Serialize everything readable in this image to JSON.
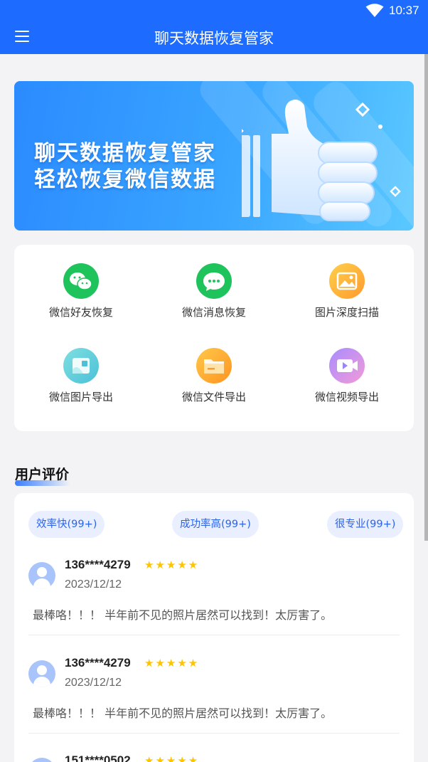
{
  "status_bar": {
    "time": "10:37",
    "wifi_icon": "wifi-icon"
  },
  "app_bar": {
    "title": "聊天数据恢复管家",
    "menu_icon": "menu-icon"
  },
  "banner": {
    "line1": "聊天数据恢复管家",
    "line2": "轻松恢复微信数据",
    "illustration": "thumbs-up-icon"
  },
  "features": [
    {
      "label": "微信好友恢复",
      "icon": "wechat-friends-icon",
      "color": "#1fc35c"
    },
    {
      "label": "微信消息恢复",
      "icon": "chat-bubble-icon",
      "color": "#1fc35c"
    },
    {
      "label": "图片深度扫描",
      "icon": "image-scan-icon",
      "color": "#ffad2e"
    },
    {
      "label": "微信图片导出",
      "icon": "image-export-icon",
      "color": "#5fd3d8"
    },
    {
      "label": "微信文件导出",
      "icon": "folder-icon",
      "color": "#ffa726"
    },
    {
      "label": "微信视频导出",
      "icon": "video-icon",
      "color": "#8a7cf5"
    }
  ],
  "reviews_section": {
    "title": "用户评价",
    "tags": [
      "效率快(99+)",
      "成功率高(99+)",
      "很专业(99+)"
    ],
    "reviews": [
      {
        "user": "136****4279",
        "stars": "★★★★★",
        "date": "2023/12/12",
        "text": "最棒咯！！！ 半年前不见的照片居然可以找到！太厉害了。"
      },
      {
        "user": "136****4279",
        "stars": "★★★★★",
        "date": "2023/12/12",
        "text": "最棒咯！！！ 半年前不见的照片居然可以找到！太厉害了。"
      },
      {
        "user": "151****0502",
        "stars": "★★★★★",
        "date": "",
        "text": ""
      }
    ]
  }
}
